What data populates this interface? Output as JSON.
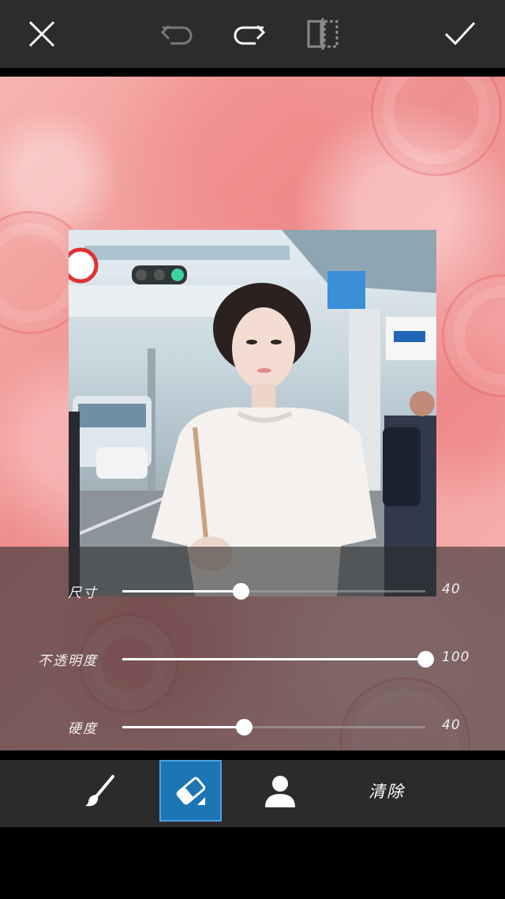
{
  "toolbar": {
    "close_icon": "close-icon",
    "undo_icon": "undo-icon",
    "redo_icon": "redo-icon",
    "compare_icon": "compare-icon",
    "apply_icon": "check-icon"
  },
  "sliders": [
    {
      "label": "尺寸",
      "value": "40",
      "fraction": 0.39
    },
    {
      "label": "不透明度",
      "value": "100",
      "fraction": 1.0
    },
    {
      "label": "硬度",
      "value": "40",
      "fraction": 0.4
    }
  ],
  "tools": {
    "brush_icon": "brush-icon",
    "eraser_icon": "eraser-icon",
    "person_icon": "person-icon",
    "active_tool": "eraser",
    "clear_label": "清除"
  },
  "colors": {
    "toolbar_bg": "#2c2c2c",
    "active_tool_bg": "#1c75b4",
    "canvas_bg": "#f2a2a2"
  }
}
